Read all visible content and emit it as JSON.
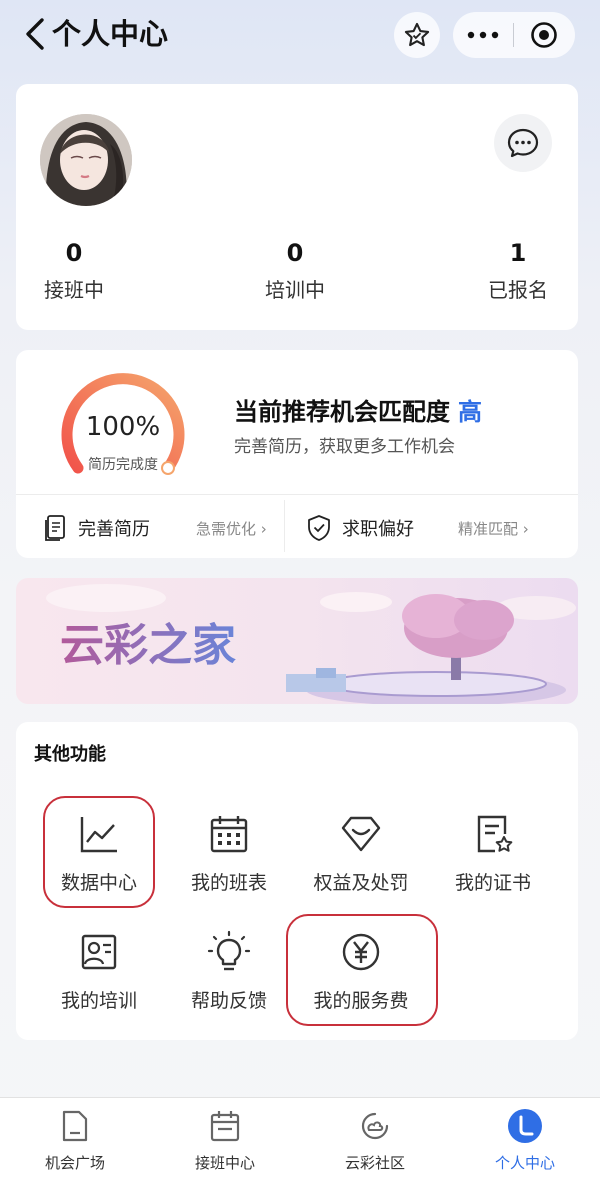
{
  "header": {
    "title": "个人中心",
    "icons": {
      "back": "chevron-left-icon",
      "star": "star-icon",
      "more": "more-icon",
      "close": "target-icon"
    }
  },
  "profile": {
    "stats": [
      {
        "value": "0",
        "label": "接班中"
      },
      {
        "value": "0",
        "label": "培训中"
      },
      {
        "value": "1",
        "label": "已报名"
      }
    ]
  },
  "resume": {
    "percent": "100%",
    "percent_value": 1.0,
    "percent_label": "简历完成度",
    "match_title": "当前推荐机会匹配度",
    "match_level": "高",
    "match_subtitle": "完善简历，获取更多工作机会",
    "options": [
      {
        "label": "完善简历",
        "hint": "急需优化"
      },
      {
        "label": "求职偏好",
        "hint": "精准匹配"
      }
    ]
  },
  "banner": {
    "text": "云彩之家"
  },
  "functions": {
    "title": "其他功能",
    "items": [
      {
        "label": "数据中心",
        "icon": "chart-icon"
      },
      {
        "label": "我的班表",
        "icon": "calendar-icon"
      },
      {
        "label": "权益及处罚",
        "icon": "shield-heart-icon"
      },
      {
        "label": "我的证书",
        "icon": "certificate-icon"
      },
      {
        "label": "我的培训",
        "icon": "training-icon"
      },
      {
        "label": "帮助反馈",
        "icon": "lightbulb-icon"
      },
      {
        "label": "我的服务费",
        "icon": "yuan-icon"
      }
    ]
  },
  "tabbar": {
    "items": [
      {
        "label": "机会广场",
        "icon": "folder-icon"
      },
      {
        "label": "接班中心",
        "icon": "calendar-icon"
      },
      {
        "label": "云彩社区",
        "icon": "community-icon"
      },
      {
        "label": "个人中心",
        "icon": "user-icon"
      }
    ],
    "active_index": 3,
    "active_color": "#2f6ee5"
  },
  "colors": {
    "accent": "#2f6ee5",
    "highlight": "#c8303b",
    "gauge_start": "#f1534a",
    "gauge_end": "#f5a56c"
  }
}
